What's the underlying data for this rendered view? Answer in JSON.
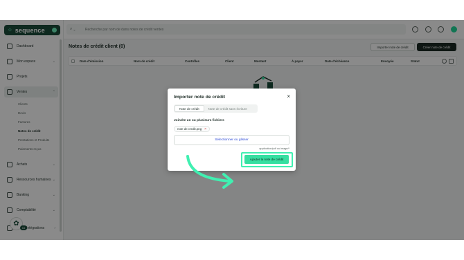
{
  "app": {
    "logo_text": "sequence"
  },
  "search": {
    "placeholder": "Recherche par nom de dans notes de crédit ventes"
  },
  "sidebar": {
    "items": [
      {
        "label": "Dashboard",
        "icon": "dashboard-icon",
        "chevron": ""
      },
      {
        "label": "Mon espace",
        "icon": "user-icon",
        "chevron": "⌄"
      },
      {
        "label": "Projets",
        "icon": "folder-icon",
        "chevron": ""
      },
      {
        "label": "Ventes",
        "icon": "sales-icon",
        "chevron": "⌃"
      },
      {
        "label": "Achats",
        "icon": "cart-icon",
        "chevron": "⌄"
      },
      {
        "label": "Ressources humaines",
        "icon": "people-icon",
        "chevron": "⌄"
      },
      {
        "label": "Banking",
        "icon": "bank-icon",
        "chevron": "⌄"
      },
      {
        "label": "Comptabilité",
        "icon": "ledger-icon",
        "chevron": "⌄"
      },
      {
        "label": "Intégrations",
        "icon": "plug-icon",
        "chevron": "›"
      }
    ],
    "sub_items": [
      "Clients",
      "Devis",
      "Factures",
      "Notes de crédit",
      "Prestations et Produits",
      "Paiements reçus"
    ],
    "active_sub": "Notes de crédit",
    "help_badge": "16"
  },
  "main": {
    "title": "Notes de crédit client (0)",
    "import_button": "Importer note de crédit",
    "create_button": "Créer note de crédit",
    "columns": [
      "Date d'émission",
      "Nom de crédit",
      "Contrôles",
      "Client",
      "Montant",
      "À payer",
      "Date d'échéance",
      "Envoyée",
      "Statut"
    ]
  },
  "modal": {
    "title": "Importer note de crédit",
    "tabs": [
      {
        "label": "Note de crédit",
        "active": true
      },
      {
        "label": "Note de crédit sans écriture",
        "active": false
      }
    ],
    "join_label": "Joindre un ou plusieurs fichiers",
    "file_name": "note de credit.png",
    "file_remove": "×",
    "dropzone_text": "Sélectionner ou glisser",
    "accept_text": "application/pdf ou image/*",
    "submit_button": "Ajouter la note de crédit",
    "close": "×"
  },
  "colors": {
    "brand_dark": "#1b4d3a",
    "accent_green": "#36dfa1",
    "highlight": "#40f0b1",
    "link_blue": "#2e4bd6"
  }
}
